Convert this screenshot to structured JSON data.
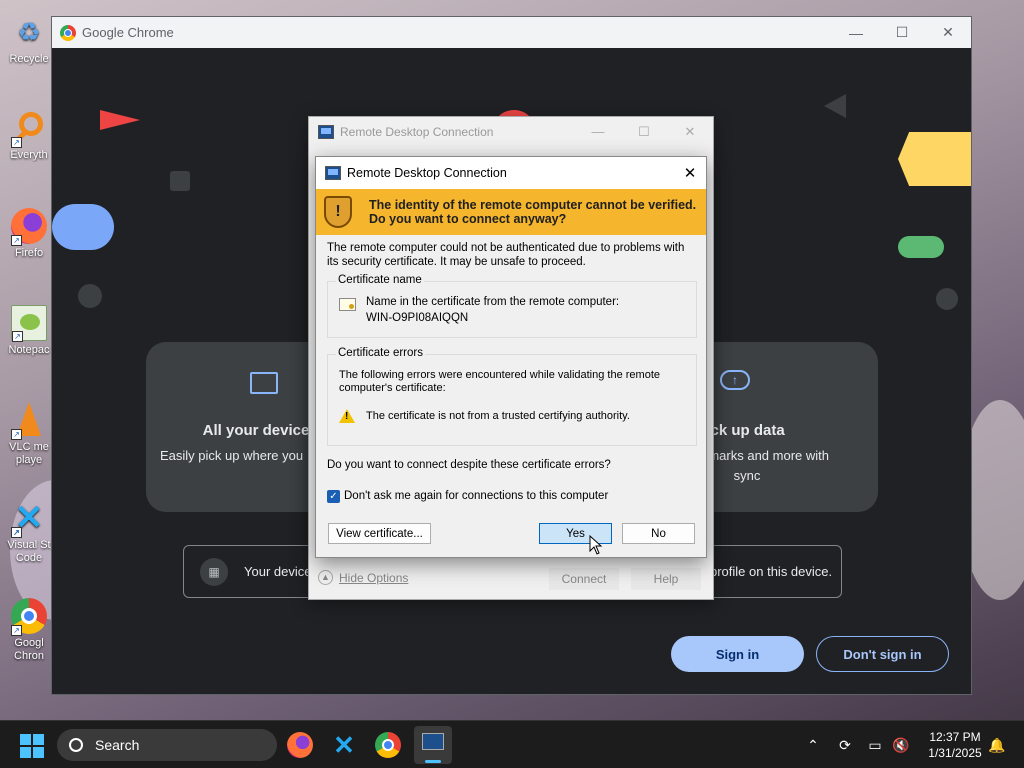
{
  "desktop": {
    "icons": [
      {
        "label": "Recycle",
        "icon": "recycle-bin-icon"
      },
      {
        "label": "Everyth",
        "icon": "everything-search-icon"
      },
      {
        "label": "Firefo",
        "icon": "firefox-icon"
      },
      {
        "label": "Notepac",
        "icon": "notepad-plus-plus-icon"
      },
      {
        "label": "VLC me playe",
        "icon": "vlc-icon"
      },
      {
        "label": "Visual St Code",
        "icon": "vscode-icon"
      },
      {
        "label": "Googl Chron",
        "icon": "chrome-icon"
      }
    ]
  },
  "chrome": {
    "title": "Google Chrome",
    "cards": [
      {
        "title": "All your device",
        "subtitle": "Easily pick up where you"
      },
      {
        "title": "Back up data",
        "subtitle": "ur bookmarks and more with sync"
      }
    ],
    "managed_text_left": "Your device",
    "managed_text_right": "profile on this device.",
    "sign_in": "Sign in",
    "dont_sign_in": "Don't sign in"
  },
  "rdc_background": {
    "title": "Remote Desktop Connection",
    "hide_options": "Hide Options",
    "connect": "Connect",
    "help": "Help"
  },
  "dialog": {
    "title": "Remote Desktop Connection",
    "warning": "The identity of the remote computer cannot be verified. Do you want to connect anyway?",
    "message": "The remote computer could not be authenticated due to problems with its security certificate. It may be unsafe to proceed.",
    "cert_name_label": "Certificate name",
    "cert_name_desc": "Name in the certificate from the remote computer:",
    "cert_name_value": "WIN-O9PI08AIQQN",
    "cert_errors_label": "Certificate errors",
    "cert_errors_desc": "The following errors were encountered while validating the remote computer's certificate:",
    "cert_error_item": "The certificate is not from a trusted certifying authority.",
    "question": "Do you want to connect despite these certificate errors?",
    "dont_ask_label": "Don't ask me again for connections to this computer",
    "dont_ask_checked": true,
    "view_cert": "View certificate...",
    "yes": "Yes",
    "no": "No"
  },
  "taskbar": {
    "search_placeholder": "Search",
    "time": "12:37 PM",
    "date": "1/31/2025"
  },
  "colors": {
    "warning_banner": "#f5b52d",
    "chrome_bg": "#202124",
    "signin_button": "#a8c7fa"
  }
}
